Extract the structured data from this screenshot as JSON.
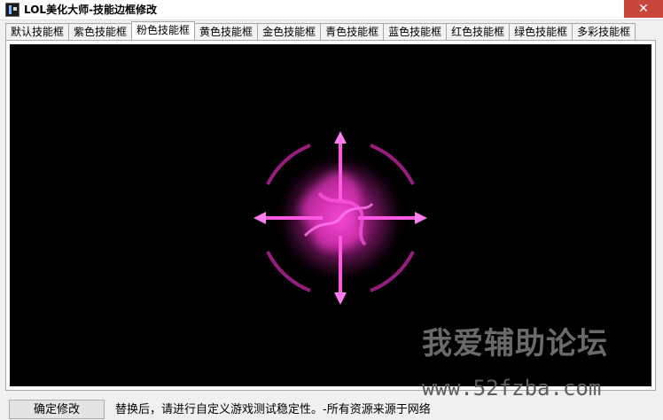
{
  "window": {
    "title": "LOL美化大师-技能边框修改",
    "close_glyph": "✕"
  },
  "tabs": [
    {
      "label": "默认技能框",
      "active": false
    },
    {
      "label": "紫色技能框",
      "active": false
    },
    {
      "label": "粉色技能框",
      "active": true
    },
    {
      "label": "黄色技能框",
      "active": false
    },
    {
      "label": "金色技能框",
      "active": false
    },
    {
      "label": "青色技能框",
      "active": false
    },
    {
      "label": "蓝色技能框",
      "active": false
    },
    {
      "label": "红色技能框",
      "active": false
    },
    {
      "label": "绿色技能框",
      "active": false
    },
    {
      "label": "多彩技能框",
      "active": false
    }
  ],
  "preview": {
    "effect_color": "#ff2fd1",
    "background": "#000000"
  },
  "watermark": {
    "cn": "我爱辅助论坛",
    "url": "www.52fzba.com"
  },
  "footer": {
    "confirm_label": "确定修改",
    "status": "替换后，请进行自定义游戏测试稳定性。-所有资源来源于网络"
  }
}
